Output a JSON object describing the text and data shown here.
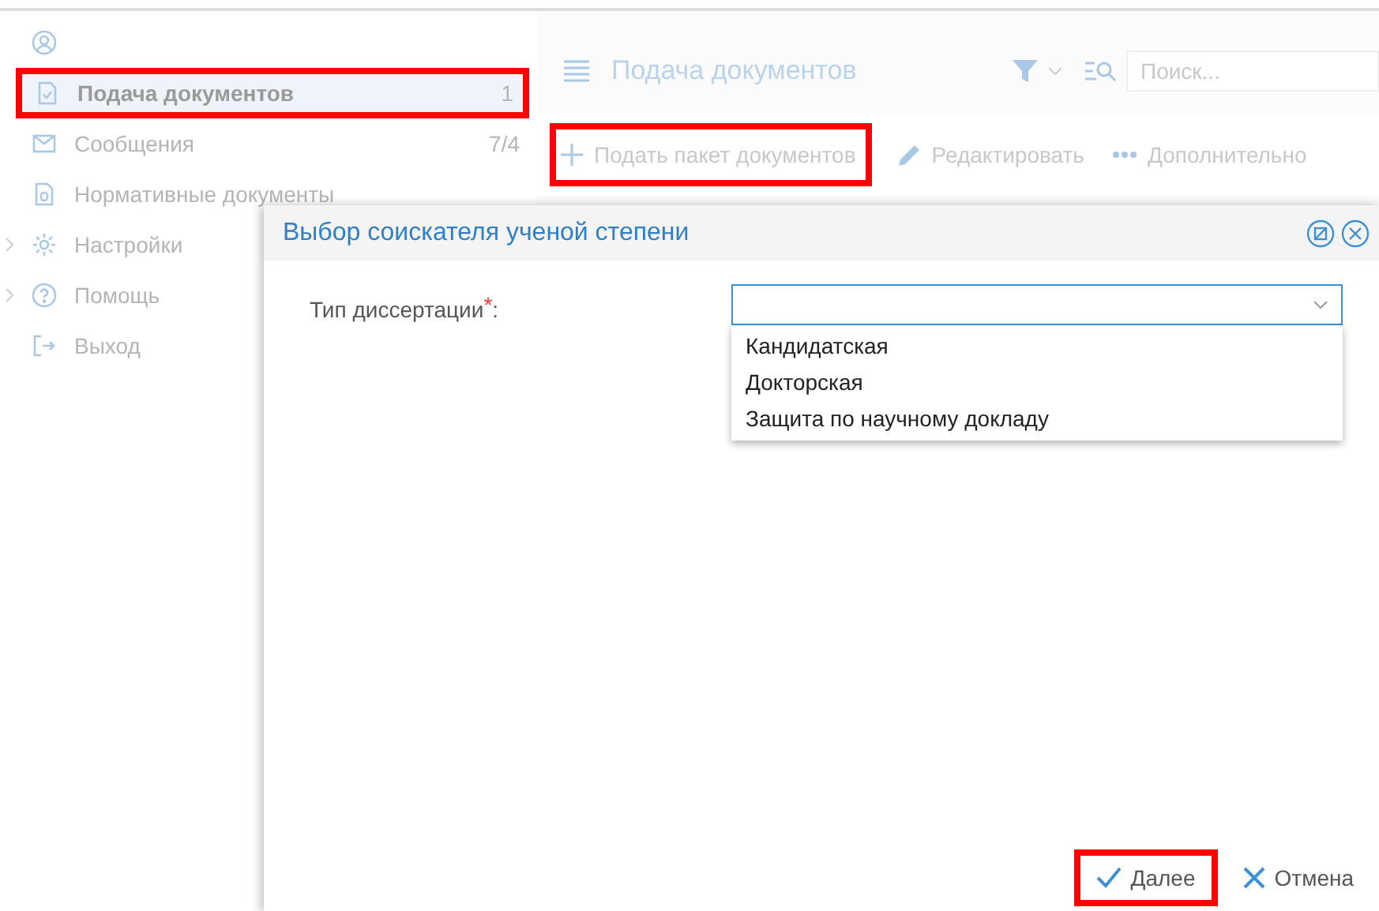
{
  "sidebar": {
    "items": [
      {
        "kind": "user",
        "selected": false,
        "highlighted": false,
        "expandable": false
      },
      {
        "kind": "doc",
        "label": "Подача документов",
        "count": "1",
        "selected": true,
        "highlighted": true,
        "expandable": false
      },
      {
        "kind": "mail",
        "label": "Сообщения",
        "count": "7/4",
        "selected": false,
        "highlighted": false,
        "expandable": false
      },
      {
        "kind": "file",
        "label": "Нормативные документы",
        "selected": false,
        "highlighted": false,
        "expandable": false
      },
      {
        "kind": "gear",
        "label": "Настройки",
        "selected": false,
        "highlighted": false,
        "expandable": true
      },
      {
        "kind": "help",
        "label": "Помощь",
        "selected": false,
        "highlighted": false,
        "expandable": true
      },
      {
        "kind": "exit",
        "label": "Выход",
        "selected": false,
        "highlighted": false,
        "expandable": false
      }
    ]
  },
  "main": {
    "title": "Подача документов",
    "search": {
      "placeholder": "Поиск..."
    },
    "toolbar": [
      {
        "kind": "plus",
        "label": "Подать пакет документов",
        "highlighted": true
      },
      {
        "kind": "pencil",
        "label": "Редактировать",
        "highlighted": false
      },
      {
        "kind": "dots",
        "label": "Дополнительно",
        "highlighted": false
      }
    ]
  },
  "dialog": {
    "title": "Выбор соискателя ученой степени",
    "field": {
      "label": "Тип диссертации",
      "required_mark": "*",
      "label_suffix": ":",
      "expanded": true,
      "options": [
        "Кандидатская",
        "Докторская",
        "Защита по научному докладу"
      ]
    },
    "buttons": [
      {
        "kind": "next",
        "label": "Далее",
        "highlighted": true
      },
      {
        "kind": "cancel",
        "label": "Отмена",
        "highlighted": false
      }
    ]
  }
}
